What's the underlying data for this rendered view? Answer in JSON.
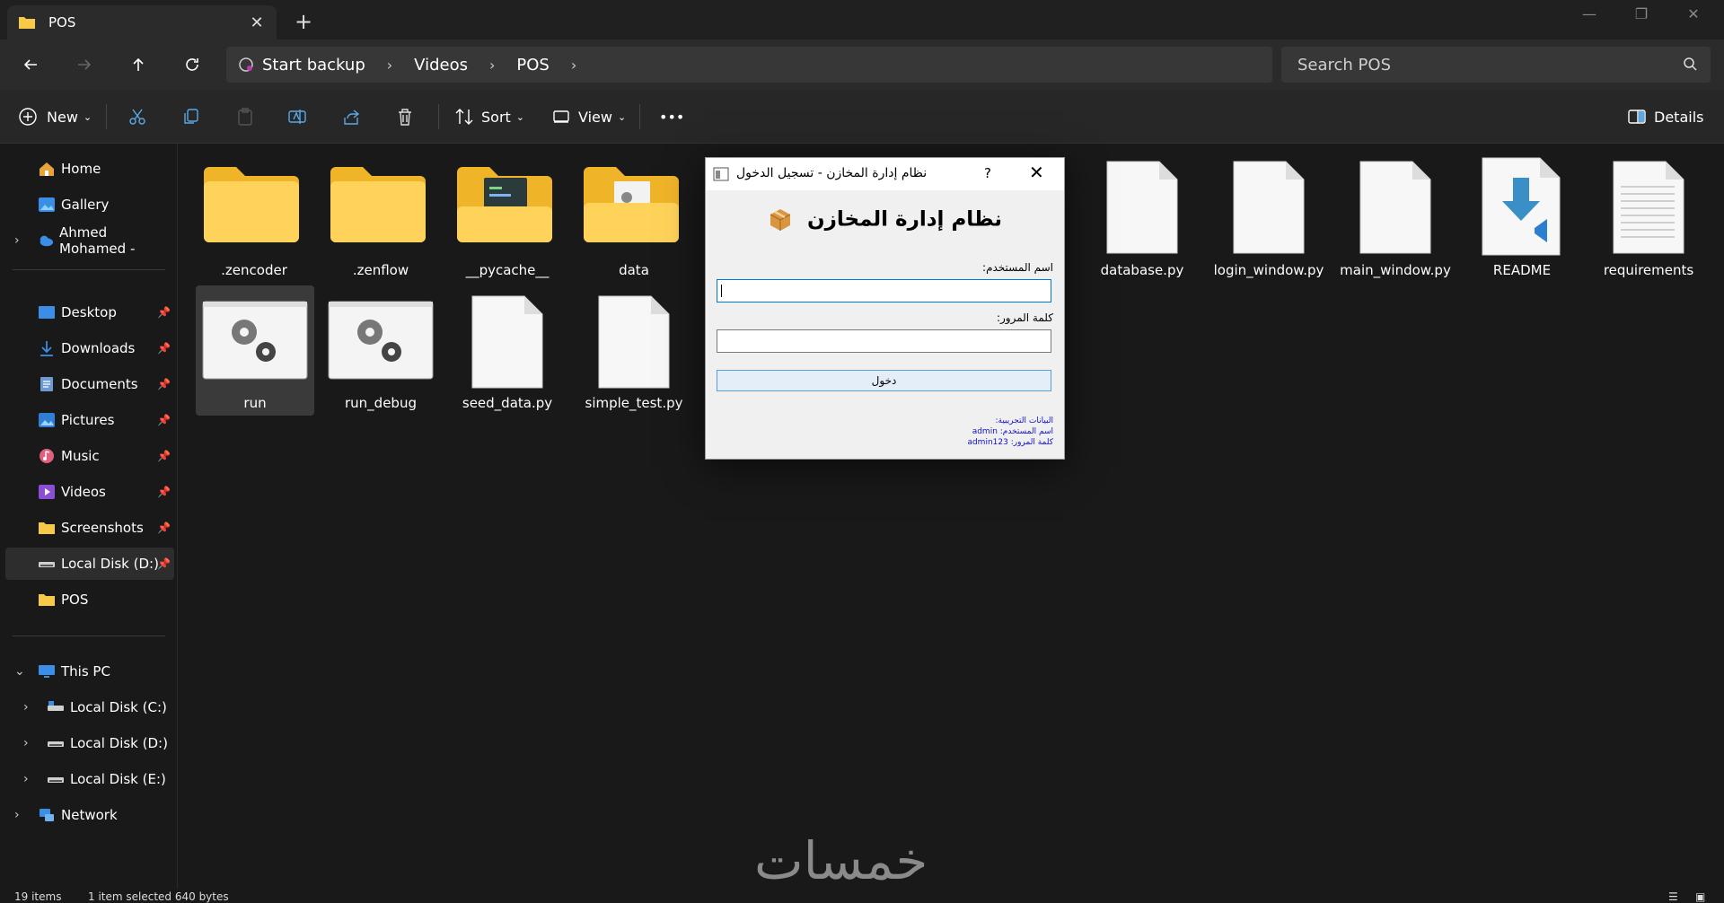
{
  "window": {
    "tab_title": "POS",
    "new_tab": "+",
    "close_tab": "✕"
  },
  "address": {
    "breadcrumbs": [
      "Start backup",
      "Videos",
      "POS"
    ],
    "search_placeholder": "Search POS"
  },
  "toolbar": {
    "new_label": "New",
    "sort_label": "Sort",
    "view_label": "View",
    "more_label": "•••",
    "details_label": "Details"
  },
  "sidebar": {
    "quick": [
      {
        "label": "Home",
        "icon": "home-icon"
      },
      {
        "label": "Gallery",
        "icon": "gallery-icon"
      },
      {
        "label": "Ahmed Mohamed -",
        "icon": "onedrive-icon"
      }
    ],
    "pinned": [
      {
        "label": "Desktop",
        "icon": "desktop-icon"
      },
      {
        "label": "Downloads",
        "icon": "download-icon"
      },
      {
        "label": "Documents",
        "icon": "documents-icon"
      },
      {
        "label": "Pictures",
        "icon": "pictures-icon"
      },
      {
        "label": "Music",
        "icon": "music-icon"
      },
      {
        "label": "Videos",
        "icon": "videos-icon"
      },
      {
        "label": "Screenshots",
        "icon": "folder-icon"
      },
      {
        "label": "Local Disk (D:)",
        "icon": "drive-icon"
      },
      {
        "label": "POS",
        "icon": "folder-icon"
      }
    ],
    "this_pc": "This PC",
    "drives": [
      "Local Disk (C:)",
      "Local Disk (D:)",
      "Local Disk (E:)"
    ],
    "network": "Network"
  },
  "files": {
    "row1": [
      ".zencoder",
      ".zenflow",
      "__pycache__",
      "data",
      "database.py",
      "login_window.py",
      "main_window.py",
      "README",
      "requirements"
    ],
    "row2": [
      "run",
      "run_debug",
      "seed_data.py",
      "simple_test.py"
    ]
  },
  "dialog": {
    "title": "نظام إدارة المخازن - تسجيل الدخول",
    "help": "?",
    "close": "✕",
    "heading": "نظام إدارة المخازن",
    "username_label": "اسم المستخدم:",
    "password_label": "كلمة المرور:",
    "login_button": "دخول",
    "hint_title": "البيانات التجريبية:",
    "hint_user": "اسم المستخدم: admin",
    "hint_pass": "كلمة المرور: admin123"
  },
  "status": {
    "items": "19 items",
    "selected": "1 item selected  640 bytes"
  },
  "watermark": "خمسات",
  "colors": {
    "accent": "#0078d7",
    "folder": "#f7c948",
    "background": "#191919"
  }
}
